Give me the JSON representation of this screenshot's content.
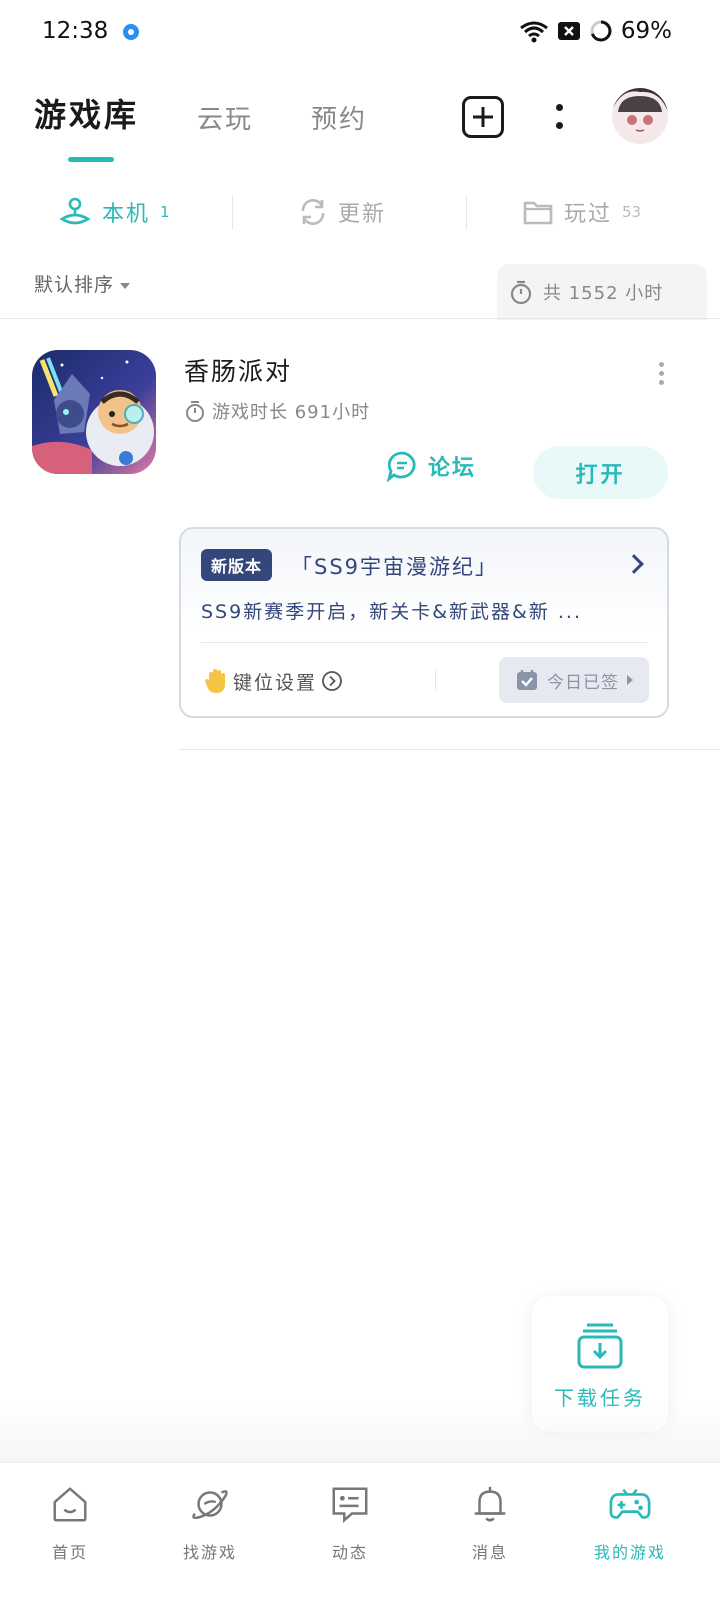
{
  "status_bar": {
    "time": "12:38",
    "battery": "69%"
  },
  "top_tabs": [
    {
      "label": "游戏库",
      "active": true
    },
    {
      "label": "云玩",
      "active": false
    },
    {
      "label": "预约",
      "active": false
    }
  ],
  "filters": [
    {
      "label": "本机",
      "count": "1",
      "icon": "joystick-icon",
      "active": true
    },
    {
      "label": "更新",
      "count": "",
      "icon": "refresh-icon",
      "active": false
    },
    {
      "label": "玩过",
      "count": "53",
      "icon": "folder-icon",
      "active": false
    }
  ],
  "sort": {
    "label": "默认排序"
  },
  "total": {
    "label": "共 1552 小时"
  },
  "game": {
    "name": "香肠派对",
    "playtime": "游戏时长 691小时",
    "forum_label": "论坛",
    "open_label": "打开"
  },
  "news": {
    "badge": "新版本",
    "title": "「SS9宇宙漫游纪」",
    "desc": "SS9新赛季开启，新关卡&新武器&新 ...",
    "key_setting": "键位设置",
    "checkin": "今日已签"
  },
  "download": {
    "label": "下载任务"
  },
  "bottom_nav": [
    {
      "label": "首页",
      "icon": "home-icon",
      "active": false
    },
    {
      "label": "找游戏",
      "icon": "planet-icon",
      "active": false
    },
    {
      "label": "动态",
      "icon": "message-icon",
      "active": false
    },
    {
      "label": "消息",
      "icon": "bell-icon",
      "active": false
    },
    {
      "label": "我的游戏",
      "icon": "gamepad-icon",
      "active": true
    }
  ],
  "colors": {
    "accent": "#2ab9b9",
    "news_navy": "#33477a",
    "text_dark": "#1a1a1a",
    "text_muted": "#888888"
  }
}
